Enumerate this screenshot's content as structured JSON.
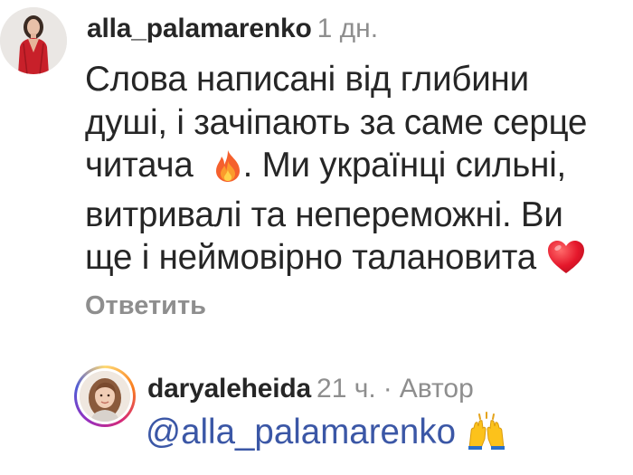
{
  "comment": {
    "username": "alla_palamarenko",
    "time": "1 дн.",
    "lines": {
      "l1": "Слова написані від глибини",
      "l2": "душі, і зачіпають за саме серце",
      "l3a": "читача",
      "l3b": ". Ми українці сильні,",
      "l4": "витривалі та непереможні. Ви",
      "l5": "ще і неймовірно талановита"
    },
    "reply_label": "Ответить",
    "emojis": [
      "fire-emoji",
      "red-heart-emoji"
    ]
  },
  "reply": {
    "username": "daryaleheida",
    "time": "21 ч.",
    "separator": "·",
    "role": "Автор",
    "mention": "@alla_palamarenko",
    "emojis": [
      "raising-hands-emoji"
    ]
  },
  "colors": {
    "text": "#262626",
    "secondary": "#8e8e8e",
    "mention": "#3b57a6",
    "story_ring": [
      "#feda75",
      "#fa7e1e",
      "#d62976",
      "#962fbf",
      "#4f5bd5"
    ]
  }
}
